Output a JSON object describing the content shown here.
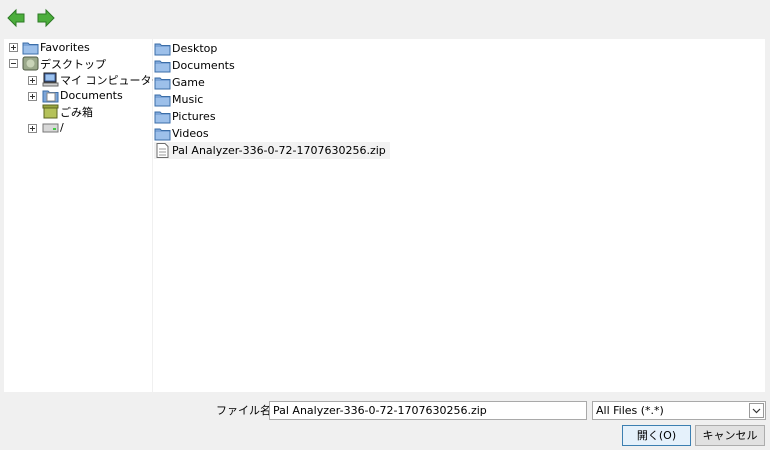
{
  "toolbar": {
    "back_icon": "arrow-left-icon",
    "forward_icon": "arrow-right-icon",
    "accent": "#3aa33a"
  },
  "tree": {
    "items": [
      {
        "label": "Favorites",
        "icon": "folder-icon",
        "expander": "plus",
        "level": 0
      },
      {
        "label": "デスクトップ",
        "icon": "desktop-icon",
        "expander": "minus",
        "level": 0
      },
      {
        "label": "マイ コンピューター",
        "icon": "computer-icon",
        "expander": "plus",
        "level": 1
      },
      {
        "label": "Documents",
        "icon": "documents-icon",
        "expander": "plus",
        "level": 1
      },
      {
        "label": "ごみ箱",
        "icon": "trash-icon",
        "expander": "none",
        "level": 1
      },
      {
        "label": "/",
        "icon": "drive-icon",
        "expander": "plus",
        "level": 1
      }
    ]
  },
  "files": {
    "items": [
      {
        "label": "Desktop",
        "icon": "folder-icon"
      },
      {
        "label": "Documents",
        "icon": "folder-icon"
      },
      {
        "label": "Game",
        "icon": "folder-icon"
      },
      {
        "label": "Music",
        "icon": "folder-icon"
      },
      {
        "label": "Pictures",
        "icon": "folder-icon"
      },
      {
        "label": "Videos",
        "icon": "folder-icon"
      },
      {
        "label": "Pal Analyzer-336-0-72-1707630256.zip",
        "icon": "file-icon",
        "selected": true
      }
    ]
  },
  "bottom": {
    "filename_label": "ファイル名:",
    "filename_value": "Pal Analyzer-336-0-72-1707630256.zip",
    "filter_value": "All Files (*.*)",
    "open_label": "開く(O)",
    "cancel_label": "キャンセル"
  }
}
